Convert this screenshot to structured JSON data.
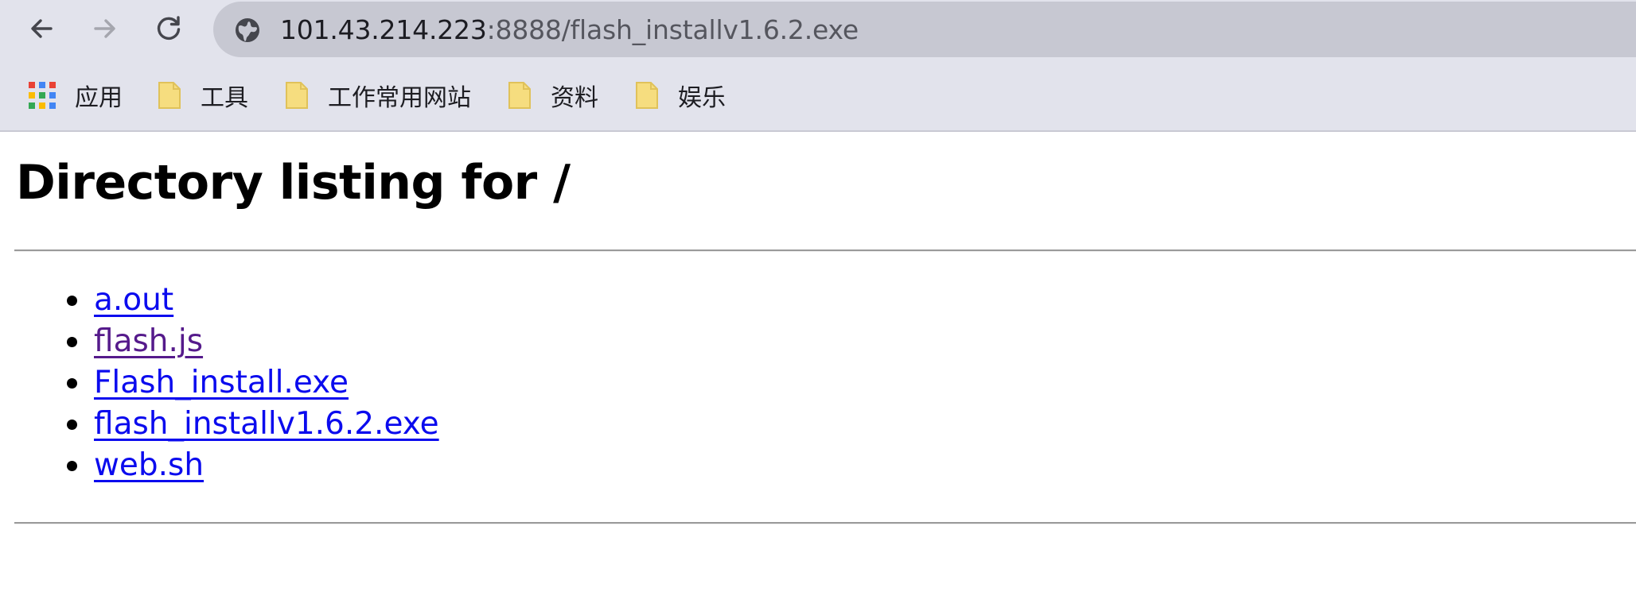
{
  "browser": {
    "url_host": "101.43.214.223",
    "url_rest": ":8888/flash_installv1.6.2.exe",
    "nav": {
      "back_icon": "arrow-left-icon",
      "forward_icon": "arrow-right-icon",
      "reload_icon": "reload-icon",
      "site_info_icon": "globe-icon"
    },
    "bookmarks": [
      {
        "label": "应用",
        "icon": "apps-grid-icon"
      },
      {
        "label": "工具",
        "icon": "folder-icon"
      },
      {
        "label": "工作常用网站",
        "icon": "folder-icon"
      },
      {
        "label": "资料",
        "icon": "folder-icon"
      },
      {
        "label": "娱乐",
        "icon": "folder-icon"
      }
    ],
    "colors": {
      "chrome_bg": "#e2e3ec",
      "omnibox_bg": "#c7c8d2",
      "folder_fill": "#f6dd7f"
    }
  },
  "page": {
    "title": "Directory listing for /",
    "files": [
      {
        "name": "a.out",
        "visited": false
      },
      {
        "name": "flash.js",
        "visited": true
      },
      {
        "name": "Flash_install.exe",
        "visited": false
      },
      {
        "name": "flash_installv1.6.2.exe",
        "visited": false
      },
      {
        "name": "web.sh",
        "visited": false
      }
    ],
    "colors": {
      "link": "#0b0bee",
      "visited_link": "#551a8b"
    }
  }
}
